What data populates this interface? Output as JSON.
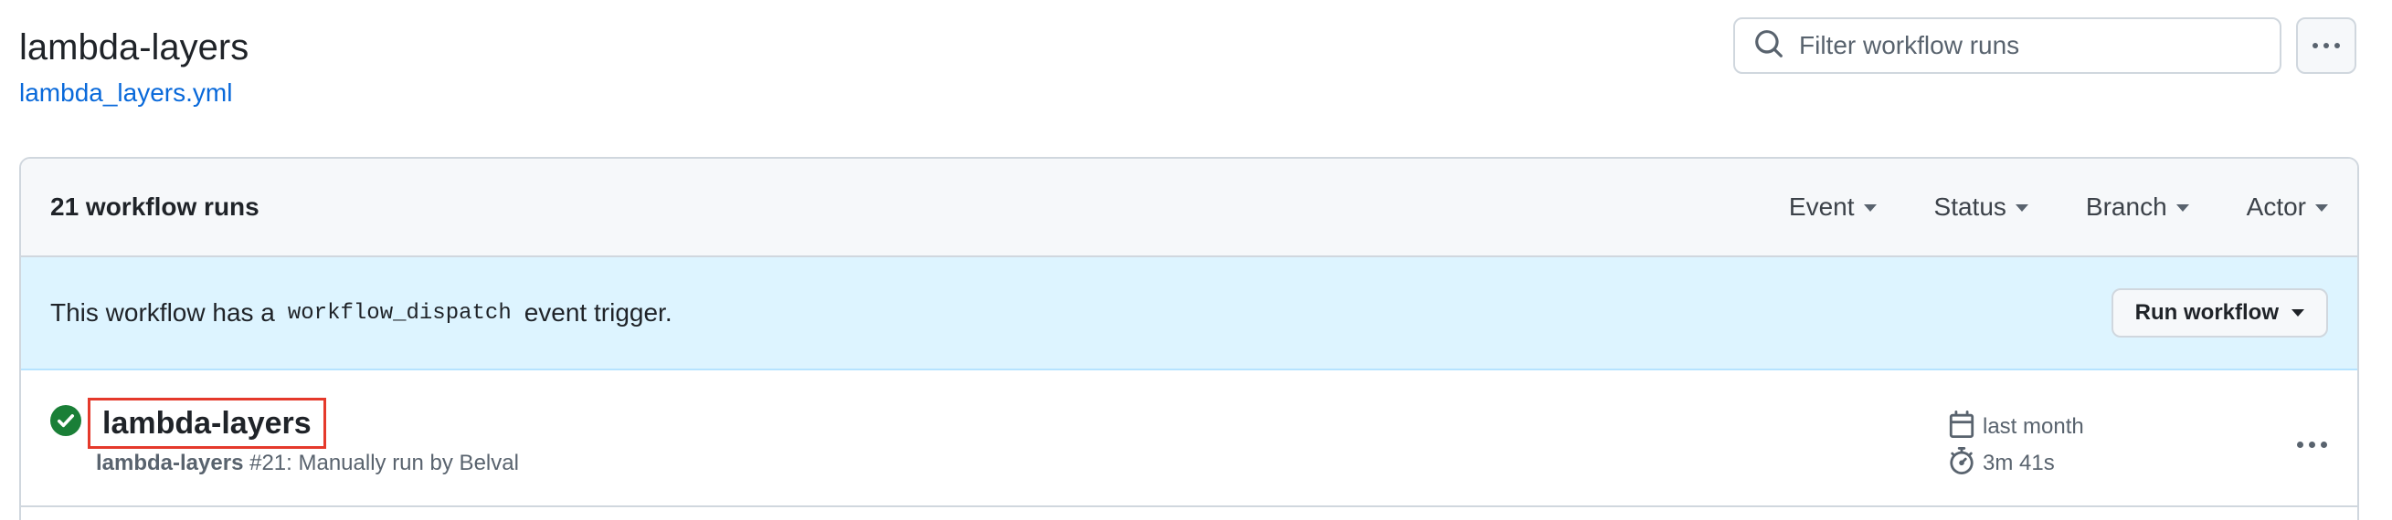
{
  "workflow": {
    "title": "lambda-layers",
    "file": "lambda_layers.yml"
  },
  "search": {
    "placeholder": "Filter workflow runs"
  },
  "runs_header": {
    "count_label": "21 workflow runs",
    "filters": [
      "Event",
      "Status",
      "Branch",
      "Actor"
    ]
  },
  "banner": {
    "text_before": "This workflow has a",
    "code": "workflow_dispatch",
    "text_after": "event trigger.",
    "button_label": "Run workflow"
  },
  "runs": [
    {
      "name": "lambda-layers",
      "workflow": "lambda-layers",
      "detail": "#21: Manually run by Belval",
      "date": "last month",
      "duration": "3m 41s",
      "status": "success"
    }
  ],
  "colors": {
    "accent_link": "#0969da",
    "success": "#1a7f37",
    "highlight_box": "#e5392b",
    "banner_bg": "#ddf4ff"
  },
  "icons": {
    "search": "search-icon",
    "more": "kebab-horizontal-icon",
    "status": "check-circle-fill-icon",
    "calendar": "calendar-icon",
    "stopwatch": "stopwatch-icon"
  }
}
